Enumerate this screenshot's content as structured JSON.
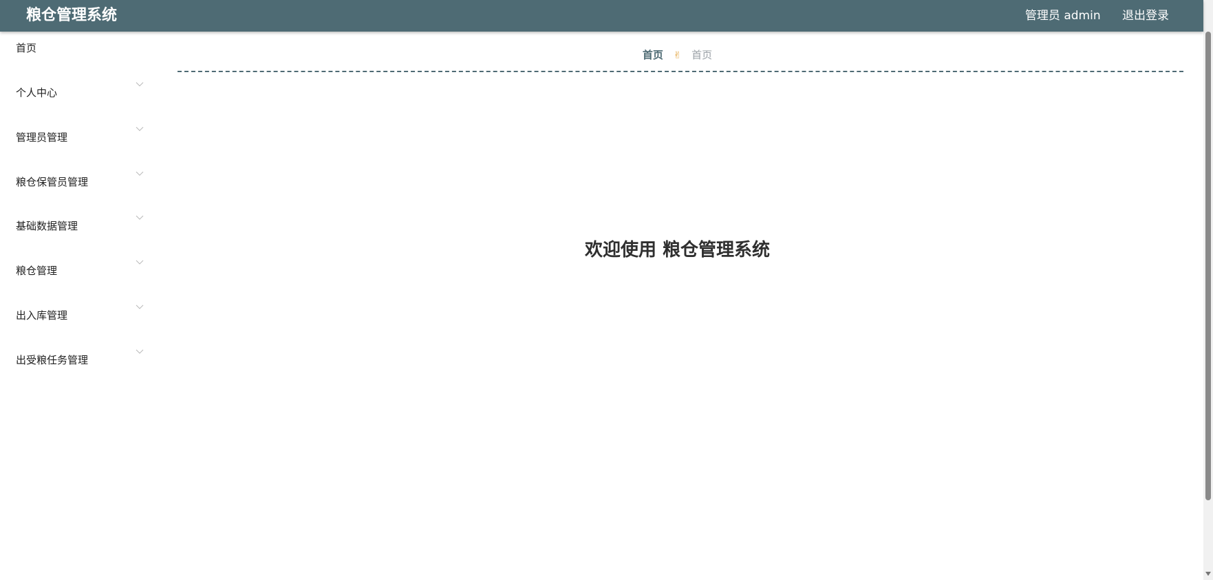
{
  "header": {
    "app_title": "粮仓管理系统",
    "user_label": "管理员 admin",
    "logout_label": "退出登录",
    "bg_color": "#4e6b74"
  },
  "sidebar": {
    "items": [
      {
        "label": "首页",
        "has_chevron": false
      },
      {
        "label": "个人中心",
        "has_chevron": true
      },
      {
        "label": "管理员管理",
        "has_chevron": true
      },
      {
        "label": "粮仓保管员管理",
        "has_chevron": true
      },
      {
        "label": "基础数据管理",
        "has_chevron": true
      },
      {
        "label": "粮仓管理",
        "has_chevron": true
      },
      {
        "label": "出入库管理",
        "has_chevron": true
      },
      {
        "label": "出受粮任务管理",
        "has_chevron": true
      }
    ],
    "chevron_icon": "chevron-down-icon"
  },
  "breadcrumb": {
    "home": "首页",
    "separator_icon": "victory-hand-icon",
    "separator_glyph": "✌",
    "current": "首页"
  },
  "main": {
    "welcome_text": "欢迎使用 粮仓管理系统"
  }
}
